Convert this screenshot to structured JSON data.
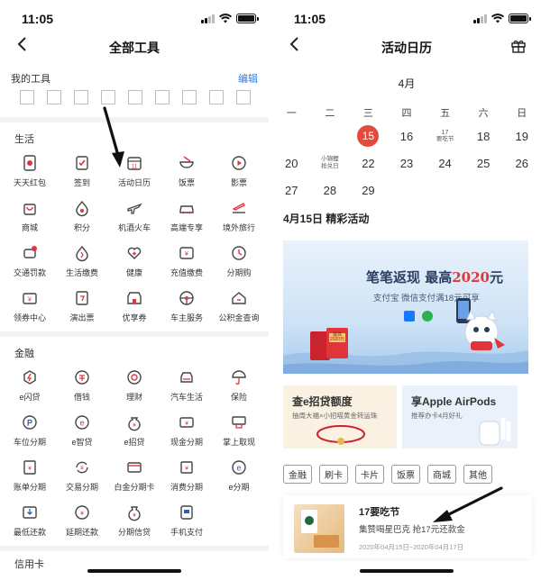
{
  "status_bar": {
    "time": "11:05"
  },
  "left": {
    "title": "全部工具",
    "my_tools": {
      "label": "我的工具",
      "edit_label": "编辑"
    },
    "sections": [
      {
        "title": "生活",
        "items": [
          "天天红包",
          "签到",
          "活动日历",
          "饭票",
          "影票",
          "商城",
          "积分",
          "机酒火车",
          "高端专享",
          "境外旅行",
          "交通罚款",
          "生活缴费",
          "健康",
          "充值缴费",
          "分期购",
          "领券中心",
          "演出票",
          "优享券",
          "车主服务",
          "公积金查询"
        ]
      },
      {
        "title": "金融",
        "items": [
          "e闪贷",
          "借钱",
          "理财",
          "汽车生活",
          "保险",
          "车位分期",
          "e智贷",
          "e招贷",
          "现金分期",
          "掌上取现",
          "账单分期",
          "交易分期",
          "白金分期卡",
          "消费分期",
          "e分期",
          "最低还款",
          "延期还款",
          "分期信贷",
          "手机支付"
        ]
      },
      {
        "title": "信用卡"
      }
    ],
    "calendar_icon_number": "11"
  },
  "right": {
    "title": "活动日历",
    "month": "4月",
    "weekdays": [
      "一",
      "二",
      "三",
      "四",
      "五",
      "六",
      "日"
    ],
    "calendar": {
      "row1": [
        "15",
        "16",
        "17",
        "要吃节",
        "18",
        "19"
      ],
      "row2": [
        "20",
        "小锦鲤",
        "抢兑日",
        "22",
        "23",
        "24",
        "25",
        "26"
      ],
      "row3": [
        "27",
        "28",
        "29"
      ]
    },
    "activity_title": "4月15日 精彩活动",
    "banner": {
      "headline_a": "笔笔返现 最高",
      "headline_b": "2020",
      "headline_c": "元",
      "subline": "支付宝 微信支付满18元可享",
      "envelope_text_a": "最高",
      "envelope_text_b": "2020元"
    },
    "cards": [
      {
        "title": "查e招贷额度",
        "sub": "抽周大福×小招喵黄金转运珠"
      },
      {
        "title": "享Apple AirPods",
        "sub": "推荐办卡4月好礼"
      }
    ],
    "chips": [
      "金融",
      "刷卡",
      "卡片",
      "饭票",
      "商城",
      "其他"
    ],
    "promo": {
      "title": "17要吃节",
      "desc": "集赞喝星巴克 抢17元还款金",
      "date": "2020年04月15日~2020年04月17日"
    }
  }
}
